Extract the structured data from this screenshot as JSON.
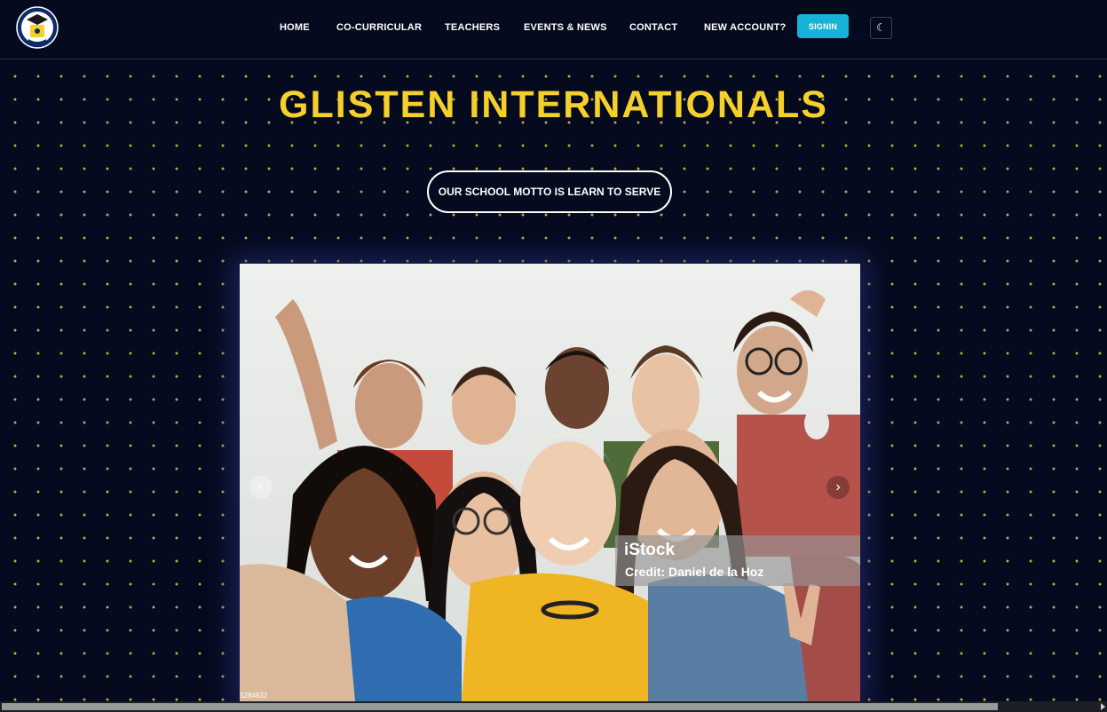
{
  "nav": {
    "logo_name": "school-crest-logo",
    "links": [
      {
        "label": "HOME"
      },
      {
        "label": "CO-CURRICULAR"
      },
      {
        "label": "TEACHERS"
      },
      {
        "label": "EVENTS & NEWS"
      },
      {
        "label": "CONTACT"
      },
      {
        "label": "NEW ACCOUNT?"
      }
    ],
    "signin_label": "SIGNIN",
    "theme_toggle_icon": "moon-icon"
  },
  "hero": {
    "title": "GLISTEN INTERNATIONALS",
    "motto_button": "OUR SCHOOL MOTTO IS LEARN TO SERVE"
  },
  "carousel": {
    "prev_icon": "chevron-left-icon",
    "next_icon": "chevron-right-icon",
    "watermark_brand": "iStock",
    "watermark_credit": "Credit: Daniel de la Hoz",
    "image_id": "5284932"
  },
  "colors": {
    "background": "#050a1e",
    "accent_yellow": "#f5d02c",
    "signin_blue": "#17b2d7"
  }
}
